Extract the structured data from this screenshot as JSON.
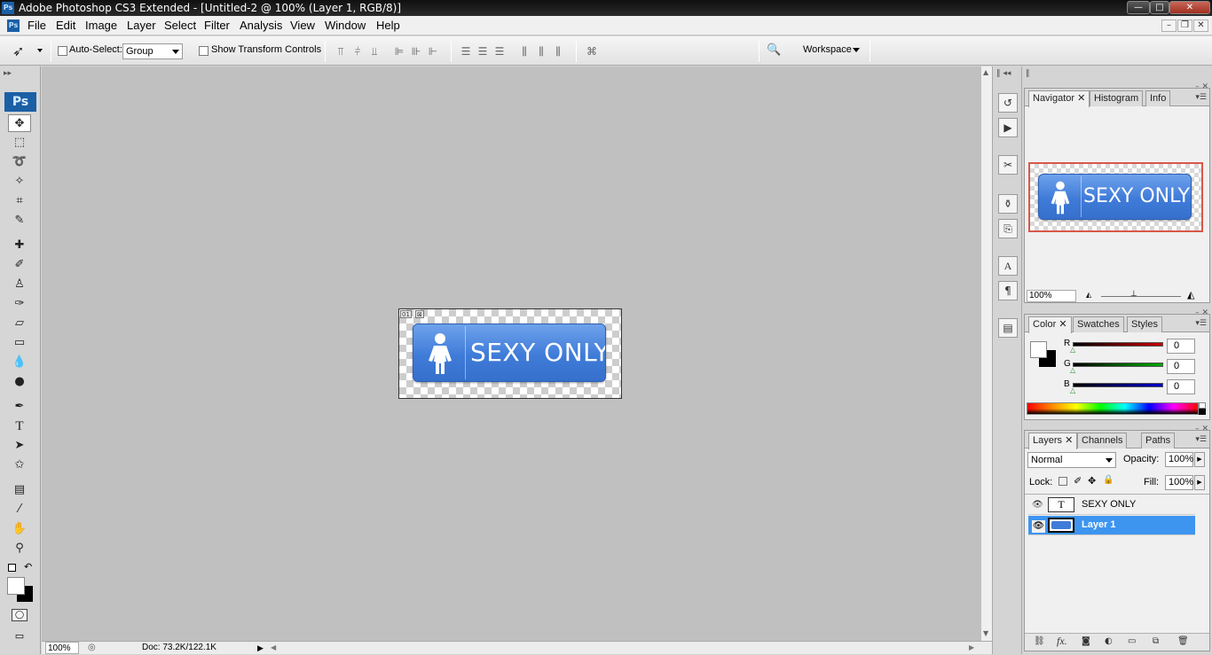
{
  "window": {
    "title": "Adobe Photoshop CS3 Extended - [Untitled-2 @ 100% (Layer 1, RGB/8)]",
    "minimize": "—",
    "maximize": "□",
    "close": "✕"
  },
  "menu": [
    "File",
    "Edit",
    "Image",
    "Layer",
    "Select",
    "Filter",
    "Analysis",
    "View",
    "Window",
    "Help"
  ],
  "options": {
    "auto_select_label": "Auto-Select:",
    "auto_select_value": "Group",
    "show_transform_label": "Show Transform Controls",
    "workspace_label": "Workspace"
  },
  "toolbox": {
    "logo": "Ps",
    "tools": [
      "move-tool",
      "marquee-tool",
      "lasso-tool",
      "magic-wand-tool",
      "crop-tool",
      "slice-tool",
      "healing-brush-tool",
      "brush-tool",
      "clone-stamp-tool",
      "history-brush-tool",
      "eraser-tool",
      "gradient-tool",
      "blur-tool",
      "dodge-tool",
      "pen-tool",
      "type-tool",
      "path-selection-tool",
      "custom-shape-tool",
      "notes-tool",
      "eyedropper-tool",
      "hand-tool",
      "zoom-tool"
    ]
  },
  "document": {
    "slice_number": "01",
    "sign_text": "SEXY ONLY"
  },
  "status": {
    "zoom": "100%",
    "doc": "Doc: 73.2K/122.1K"
  },
  "navigator": {
    "tabs": [
      "Navigator",
      "Histogram",
      "Info"
    ],
    "zoom": "100%",
    "preview_text": "SEXY ONLY"
  },
  "color": {
    "tabs": [
      "Color",
      "Swatches",
      "Styles"
    ],
    "channels": [
      {
        "label": "R",
        "value": "0",
        "color": "#cc0000"
      },
      {
        "label": "G",
        "value": "0",
        "color": "#00aa00"
      },
      {
        "label": "B",
        "value": "0",
        "color": "#0000cc"
      }
    ]
  },
  "layers": {
    "tabs": [
      "Layers",
      "Channels",
      "Paths"
    ],
    "blend_mode": "Normal",
    "opacity_label": "Opacity:",
    "opacity": "100%",
    "lock_label": "Lock:",
    "fill_label": "Fill:",
    "fill": "100%",
    "rows": [
      {
        "name": "SEXY ONLY",
        "thumb": "T",
        "selected": false
      },
      {
        "name": "Layer 1",
        "thumb": "",
        "selected": true
      }
    ]
  },
  "colors": {
    "selection": "#3d95f0",
    "sign_blue": "#3f7bd8"
  }
}
